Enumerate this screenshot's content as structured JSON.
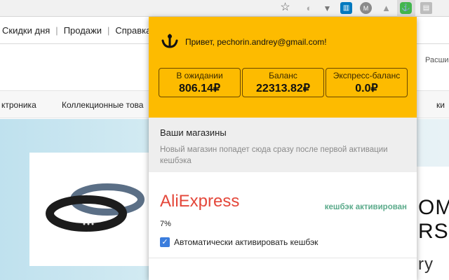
{
  "toolbar": {
    "icons": [
      "star-icon",
      "extension-icon",
      "extension-icon",
      "trello-icon",
      "m-icon",
      "drive-icon",
      "cashback-icon",
      "extension-icon"
    ]
  },
  "page": {
    "nav_links": [
      "Скидки дня",
      "Продажи",
      "Справка"
    ],
    "extensions_hint": "Расшир",
    "categories": [
      "ктроника",
      "Коллекционные това",
      "ки"
    ],
    "right_text_lines": [
      "OM",
      "RS",
      "ry"
    ]
  },
  "popup": {
    "greeting": "Привет, pechorin.andrey@gmail.com!",
    "balances": [
      {
        "label": "В ожидании",
        "value": "806.14₽"
      },
      {
        "label": "Баланс",
        "value": "22313.82₽"
      },
      {
        "label": "Экспресс-баланс",
        "value": "0.0₽"
      }
    ],
    "shops_title": "Ваши магазины",
    "shops_desc": "Новый магазин попадет сюда сразу после первой активации кешбэка",
    "store": {
      "name": "AliExpress",
      "status": "кешбэк активирован",
      "percent": "7%",
      "auto_label": "Автоматически активировать кешбэк",
      "auto_checked": true
    },
    "colors": {
      "header": "#fdbb00",
      "store_name": "#e4473a",
      "status": "#5aaa8a",
      "checkbox": "#3b7ddd"
    }
  }
}
